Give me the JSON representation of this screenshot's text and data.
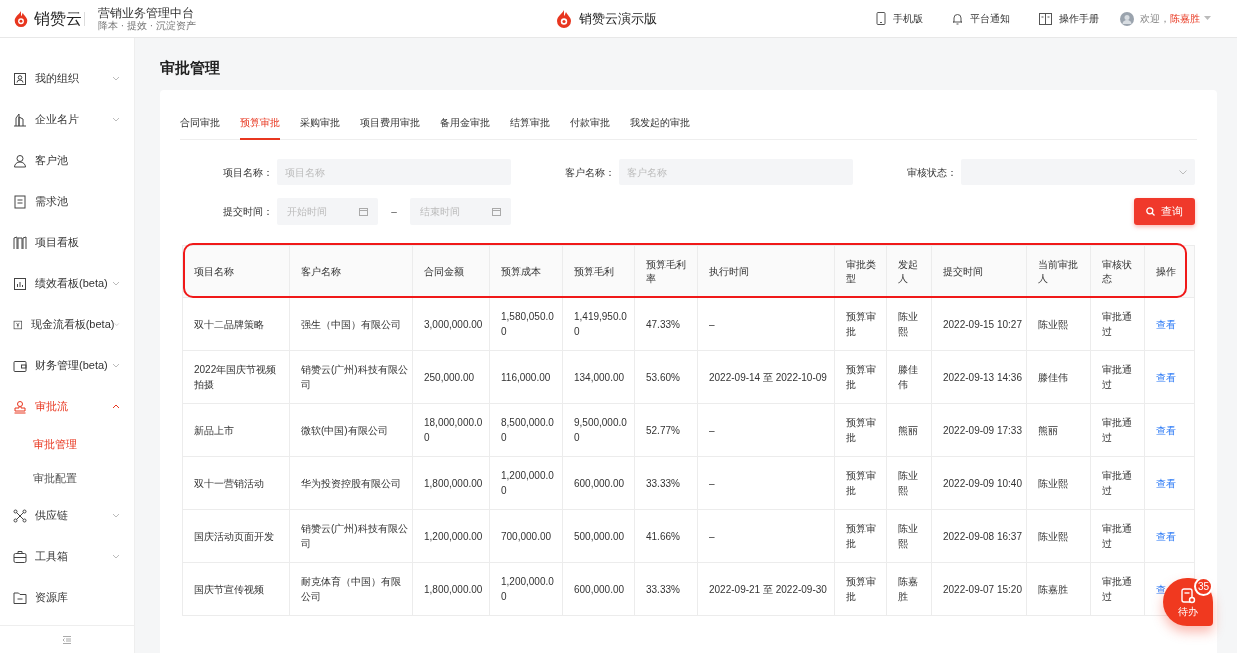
{
  "header": {
    "logo": "销赞云",
    "title": "营销业务管理中台",
    "subtitle": "降本 · 提效 · 沉淀资产",
    "center_title": "销赞云演示版",
    "links": [
      {
        "label": "手机版"
      },
      {
        "label": "平台通知"
      },
      {
        "label": "操作手册"
      }
    ],
    "welcome": "欢迎，",
    "user": "陈嘉胜"
  },
  "sidebar": {
    "items": [
      {
        "label": "我的组织",
        "kind": "group",
        "expanded": false,
        "selected": false
      },
      {
        "label": "企业名片",
        "kind": "group",
        "expanded": false,
        "selected": false
      },
      {
        "label": "客户池",
        "kind": "link",
        "selected": false
      },
      {
        "label": "需求池",
        "kind": "link",
        "selected": false
      },
      {
        "label": "项目看板",
        "kind": "link",
        "selected": false
      },
      {
        "label": "绩效看板(beta)",
        "kind": "group",
        "expanded": false,
        "selected": false
      },
      {
        "label": "现金流看板(beta)",
        "kind": "group",
        "expanded": false,
        "selected": false
      },
      {
        "label": "财务管理(beta)",
        "kind": "group",
        "expanded": false,
        "selected": false
      },
      {
        "label": "审批流",
        "kind": "group",
        "expanded": true,
        "selected": true,
        "children": [
          {
            "label": "审批管理",
            "selected": true
          },
          {
            "label": "审批配置",
            "selected": false
          }
        ]
      },
      {
        "label": "供应链",
        "kind": "group",
        "expanded": false,
        "selected": false
      },
      {
        "label": "工具箱",
        "kind": "group",
        "expanded": false,
        "selected": false
      },
      {
        "label": "资源库",
        "kind": "link",
        "selected": false
      }
    ]
  },
  "page_title": "审批管理",
  "tabs": [
    {
      "label": "合同审批",
      "selected": false
    },
    {
      "label": "预算审批",
      "selected": true
    },
    {
      "label": "采购审批",
      "selected": false
    },
    {
      "label": "项目费用审批",
      "selected": false
    },
    {
      "label": "备用金审批",
      "selected": false
    },
    {
      "label": "结算审批",
      "selected": false
    },
    {
      "label": "付款审批",
      "selected": false
    },
    {
      "label": "我发起的审批",
      "selected": false
    }
  ],
  "filters": {
    "project": {
      "label": "项目名称：",
      "placeholder": "项目名称"
    },
    "customer": {
      "label": "客户名称：",
      "placeholder": "客户名称"
    },
    "status": {
      "label": "审核状态："
    },
    "submit_time": {
      "label": "提交时间：",
      "start_placeholder": "开始时间",
      "separator": "–",
      "end_placeholder": "结束时间"
    },
    "search_button": "查询"
  },
  "table": {
    "header_highlighted": true,
    "columns": [
      "项目名称",
      "客户名称",
      "合同金额",
      "预算成本",
      "预算毛利",
      "预算毛利率",
      "执行时间",
      "审批类型",
      "发起人",
      "提交时间",
      "当前审批人",
      "审核状态",
      "操作"
    ],
    "rows": [
      [
        "双十二品牌策略",
        "强生（中国）有限公司",
        "3,000,000.00",
        "1,580,050.00",
        "1,419,950.00",
        "47.33%",
        "–",
        "预算审批",
        "陈业熙",
        "2022-09-15 10:27",
        "陈业熙",
        "审批通过",
        "查看"
      ],
      [
        "2022年国庆节视频拍摄",
        "销赞云(广州)科技有限公司",
        "250,000.00",
        "116,000.00",
        "134,000.00",
        "53.60%",
        "2022-09-14 至 2022-10-09",
        "预算审批",
        "滕佳伟",
        "2022-09-13 14:36",
        "滕佳伟",
        "审批通过",
        "查看"
      ],
      [
        "新品上市",
        "微软(中国)有限公司",
        "18,000,000.00",
        "8,500,000.00",
        "9,500,000.00",
        "52.77%",
        "–",
        "预算审批",
        "熊丽",
        "2022-09-09 17:33",
        "熊丽",
        "审批通过",
        "查看"
      ],
      [
        "双十一营销活动",
        "华为投资控股有限公司",
        "1,800,000.00",
        "1,200,000.00",
        "600,000.00",
        "33.33%",
        "–",
        "预算审批",
        "陈业熙",
        "2022-09-09 10:40",
        "陈业熙",
        "审批通过",
        "查看"
      ],
      [
        "国庆活动页面开发",
        "销赞云(广州)科技有限公司",
        "1,200,000.00",
        "700,000.00",
        "500,000.00",
        "41.66%",
        "–",
        "预算审批",
        "陈业熙",
        "2022-09-08 16:37",
        "陈业熙",
        "审批通过",
        "查看"
      ],
      [
        "国庆节宣传视频",
        "耐克体育（中国）有限公司",
        "1,800,000.00",
        "1,200,000.00",
        "600,000.00",
        "33.33%",
        "2022-09-21 至 2022-09-30",
        "预算审批",
        "陈嘉胜",
        "2022-09-07 15:20",
        "陈嘉胜",
        "审批通过",
        "查"
      ]
    ]
  },
  "todo_button": {
    "label": "待办",
    "badge": "35"
  }
}
